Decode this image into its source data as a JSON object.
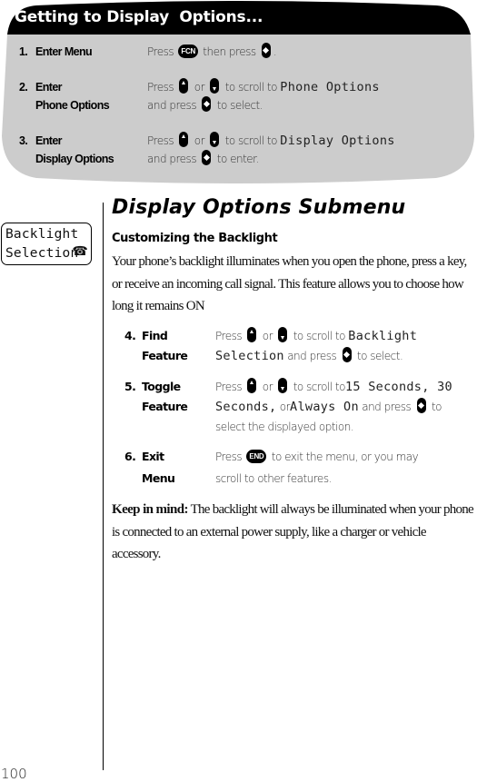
{
  "header": {
    "title": "Getting to Display  Options...",
    "colors": {
      "title_bar": "#000000",
      "panel": "#cccccc"
    },
    "steps": [
      {
        "number": "1.",
        "label": [
          "Enter Menu"
        ],
        "desc": {
          "press": "Press",
          "key1": "FCN",
          "mid": "then press",
          "end": "."
        }
      },
      {
        "number": "2.",
        "label": [
          "Enter",
          "Phone Options"
        ],
        "desc": {
          "press": "Press",
          "or": "or",
          "scroll": "to scroll to",
          "lcd": "Phone Options",
          "and_press": "and press",
          "end": "to select."
        }
      },
      {
        "number": "3.",
        "label": [
          "Enter",
          "Display Options"
        ],
        "desc": {
          "press": "Press",
          "or": "or",
          "scroll": "to scroll to",
          "lcd": "Display Options",
          "and_press": "and press",
          "end": "to enter."
        }
      }
    ]
  },
  "sidebar": {
    "lcd_lines": [
      "Backlight",
      "Selection"
    ],
    "lcd_icon": "phone-icon",
    "page_number": "100"
  },
  "main": {
    "title": "Display Options Submenu",
    "subhead": "Customizing the Backlight",
    "intro": "Your phone’s backlight illuminates when you open the phone, press a key, or receive an incoming call signal. This feature allows you to choose how long it remains ON",
    "steps": [
      {
        "number": "4.",
        "label": [
          "Find",
          "Feature"
        ],
        "press": "Press",
        "or": "or",
        "scroll": "to scroll to",
        "lcd1": "Backlight",
        "lcd2": "Selection",
        "and_press": "and press",
        "end": "to select."
      },
      {
        "number": "5.",
        "label": [
          "Toggle",
          "Feature"
        ],
        "press": "Press",
        "or": "or",
        "scroll": "to scroll to",
        "lcd1": "15 Seconds, 30",
        "lcd2": "Seconds,",
        "or2": "or",
        "lcd3": "Always On",
        "and_press": "and press",
        "to": "to",
        "line3": "select the displayed option."
      },
      {
        "number": "6.",
        "label": [
          "Exit",
          "Menu"
        ],
        "press": "Press",
        "key": "END",
        "line1": "to exit the menu, or you may",
        "line2": "scroll to other features."
      }
    ],
    "keep_in_mind": {
      "label": "Keep in mind:",
      "text": "The backlight will always be illuminated when your phone is connected to an external power supply, like a charger or vehicle accessory."
    }
  }
}
